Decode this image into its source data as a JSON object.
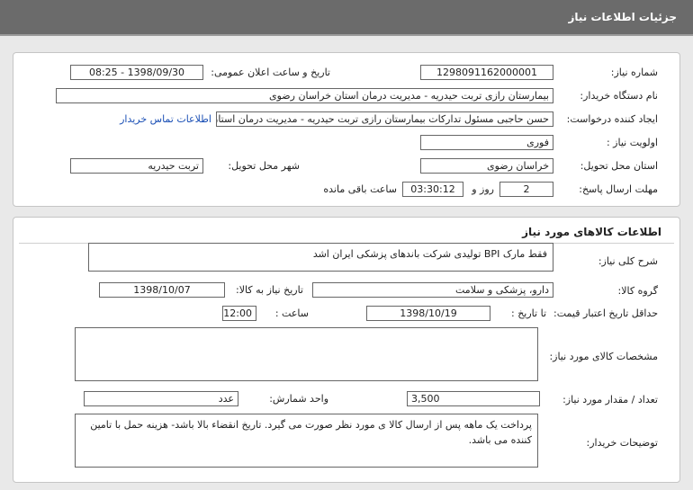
{
  "header": {
    "title": "جزئیات اطلاعات نیاز"
  },
  "need_info": {
    "need_number_label": "شماره نیاز:",
    "need_number": "1298091162000001",
    "announce_label": "تاریخ و ساعت اعلان عمومی:",
    "announce_value": "1398/09/30 - 08:25",
    "buyer_label": "نام دستگاه خریدار:",
    "buyer_value": "بیمارستان رازی تربت حیدریه - مدیریت درمان استان خراسان رضوی",
    "creator_label": "ایجاد کننده درخواست:",
    "creator_value": "حسن حاجبی مسئول تدارکات بیمارستان رازی تربت حیدریه - مدیریت درمان استان",
    "contact_link": "اطلاعات تماس خریدار",
    "priority_label": "اولویت نیاز :",
    "priority_value": "فوری",
    "province_label": "استان محل تحویل:",
    "province_value": "خراسان رضوی",
    "city_label": "شهر محل تحویل:",
    "city_value": "تربت حیدریه",
    "deadline_label": "مهلت ارسال پاسخ:",
    "days_value": "2",
    "days_and": "روز و",
    "time_value": "03:30:12",
    "remaining": "ساعت باقی مانده"
  },
  "goods": {
    "section_title": "اطلاعات کالاهای مورد نیاز",
    "desc_label": "شرح کلی نیاز:",
    "desc_value": "فقط مارک BPI تولیدی شرکت باندهای پزشکی ایران اشد",
    "group_label": "گروه کالا:",
    "group_value": "دارو، پزشکی و سلامت",
    "need_date_label": "تاریخ نیاز به کالا:",
    "need_date_value": "1398/10/07",
    "validity_label": "حداقل تاریخ اعتبار قیمت:",
    "until_date_label": "تا تاریخ :",
    "until_date_value": "1398/10/19",
    "hour_label": "ساعت :",
    "hour_value": "12:00",
    "specs_label": "مشخصات کالای مورد نیاز:",
    "specs_value": "",
    "qty_label": "تعداد / مقدار مورد نیاز:",
    "qty_value": "3,500",
    "unit_label": "واحد شمارش:",
    "unit_value": "عدد",
    "notes_label": "توضیحات خریدار:",
    "notes_value": "پرداخت یک ماهه پس از ارسال کالا ی مورد نظر صورت می گیرد. تاریخ انقضاء بالا باشد- هزینه حمل با تامین کننده می باشد."
  }
}
